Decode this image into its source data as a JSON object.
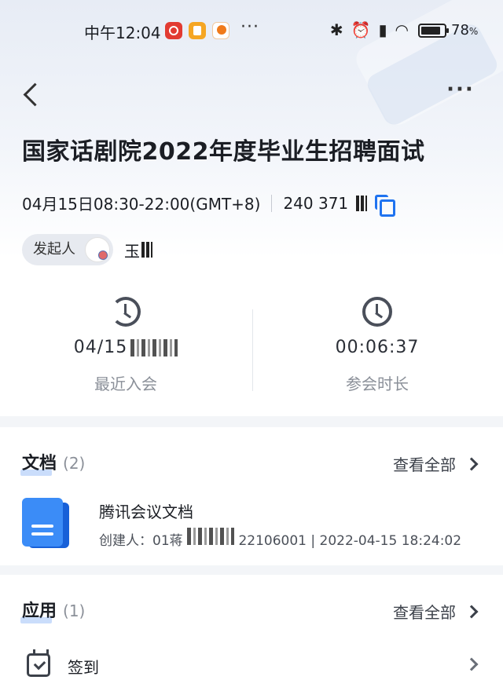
{
  "status_bar": {
    "time": "中午12:04",
    "dots": "···",
    "battery": "78",
    "battery_unit": "%"
  },
  "meeting": {
    "title": "国家话剧院2022年度毕业生招聘面试",
    "time_range": "04月15日08:30-22:00(GMT+8)",
    "meeting_id": "240 371",
    "host_label": "发起人",
    "host_name": "玉"
  },
  "stats": {
    "recent_join_value": "04/15",
    "recent_join_label": "最近入会",
    "duration_value": "00:06:37",
    "duration_label": "参会时长"
  },
  "documents": {
    "title": "文档",
    "count": "(2)",
    "view_all": "查看全部",
    "items": [
      {
        "name": "腾讯会议文档",
        "creator_label": "创建人：01蒋",
        "creator_suffix": "22106001 | 2022-04-15 18:24:02"
      }
    ]
  },
  "apps": {
    "title": "应用",
    "count": "(1)",
    "view_all": "查看全部",
    "items": [
      {
        "name": "签到"
      }
    ]
  }
}
